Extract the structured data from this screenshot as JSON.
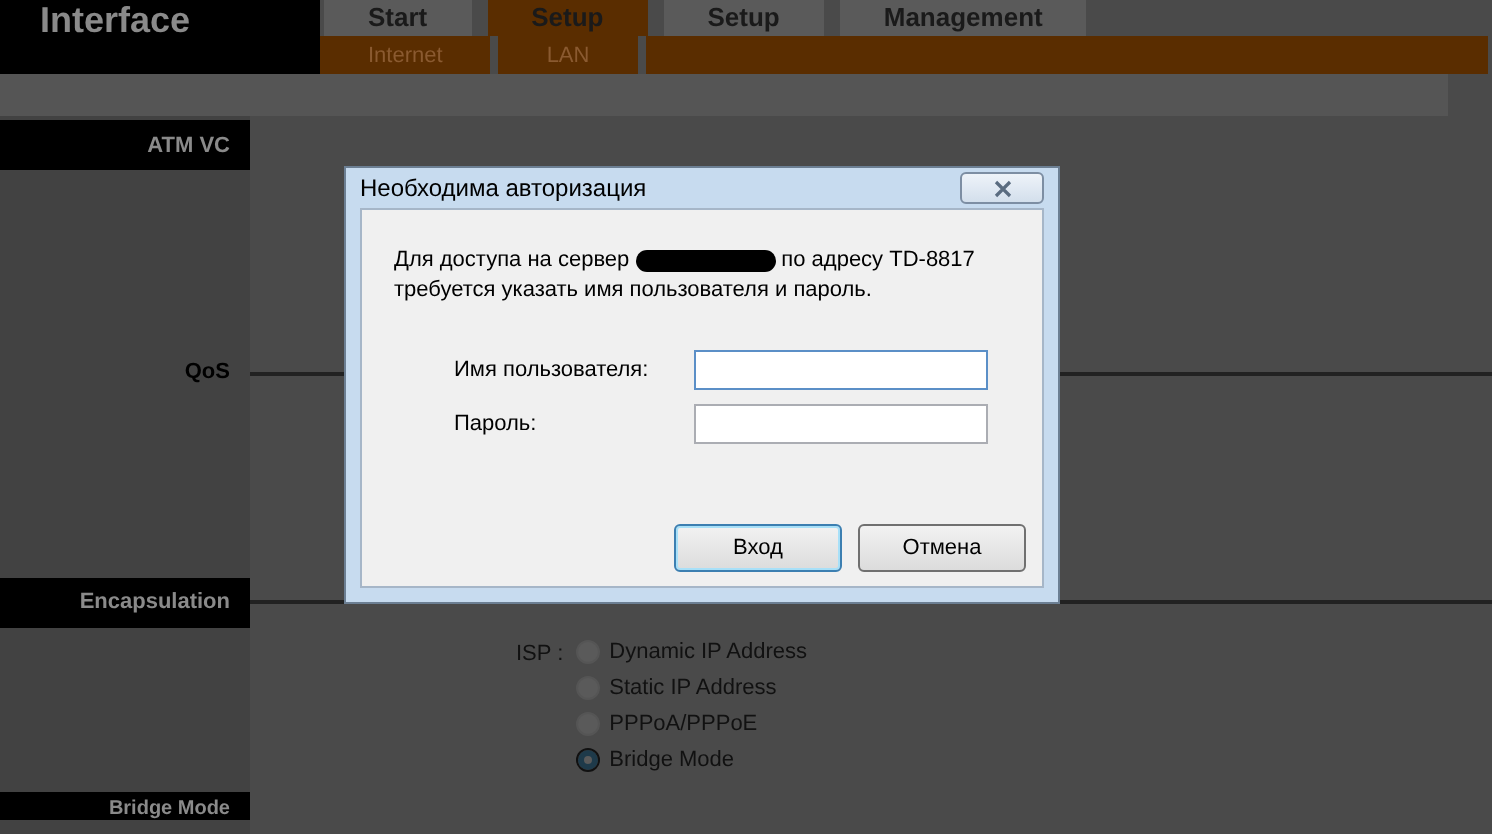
{
  "header": {
    "title": "Interface",
    "tabs": [
      {
        "label": "Start",
        "selected": false
      },
      {
        "label": "Setup",
        "selected": true
      },
      {
        "label": "Setup",
        "selected": false
      },
      {
        "label": "Management",
        "selected": false
      }
    ],
    "subtabs": [
      {
        "label": "Internet",
        "selected": false
      },
      {
        "label": "LAN",
        "selected": false
      }
    ]
  },
  "sections": [
    {
      "kind": "bar",
      "label": "ATM VC"
    },
    {
      "kind": "line",
      "label": "QoS"
    },
    {
      "kind": "bar",
      "label": "Encapsulation"
    }
  ],
  "isp": {
    "label": "ISP :",
    "options": [
      {
        "label": "Dynamic IP Address",
        "selected": false
      },
      {
        "label": "Static IP Address",
        "selected": false
      },
      {
        "label": "PPPoA/PPPoE",
        "selected": false
      },
      {
        "label": "Bridge Mode",
        "selected": true
      }
    ]
  },
  "bottom_section": {
    "label": "Bridge Mode"
  },
  "dialog": {
    "title": "Необходима авторизация",
    "message_before": "Для доступа на сервер",
    "message_after": "по адресу TD-8817",
    "message_line2": "требуется указать имя пользователя и пароль.",
    "fields": [
      {
        "label": "Имя пользователя:",
        "focused": true
      },
      {
        "label": "Пароль:",
        "focused": false
      }
    ],
    "buttons": [
      {
        "label": "Вход",
        "default": true
      },
      {
        "label": "Отмена",
        "default": false
      }
    ]
  }
}
